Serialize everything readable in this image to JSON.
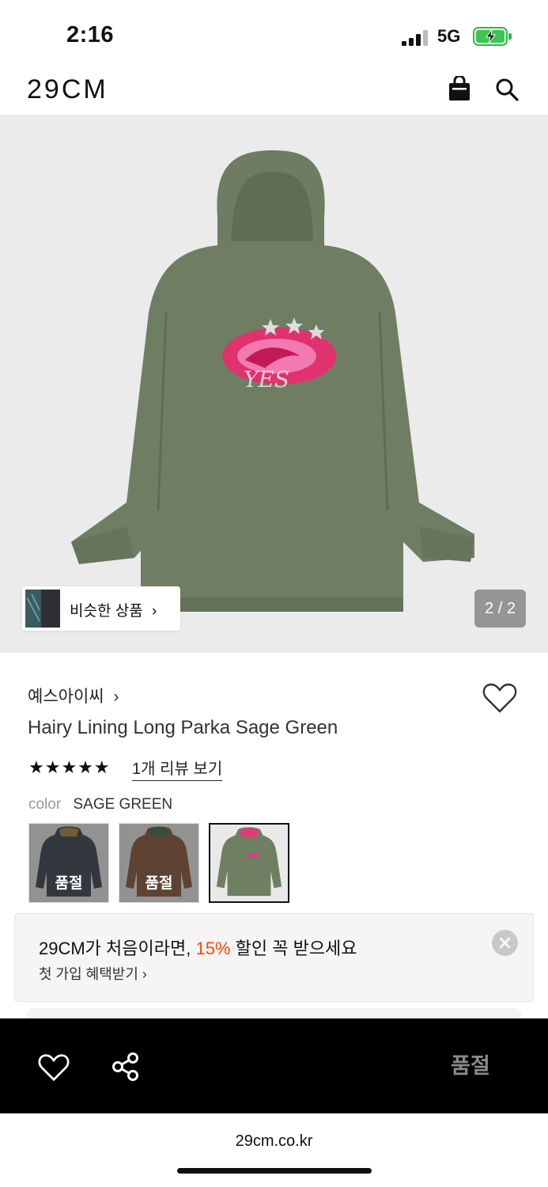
{
  "status_bar": {
    "time": "2:16",
    "network": "5G"
  },
  "header": {
    "logo": "29CM"
  },
  "gallery": {
    "similar_label": "비슷한 상품",
    "similar_chevron": "›",
    "counter": "2 / 2"
  },
  "product": {
    "brand": "예스아이씨",
    "brand_chevron": "›",
    "title": "Hairy Lining Long Parka Sage Green",
    "stars": "★★★★★",
    "review_link": "1개 리뷰 보기",
    "color_key": "color",
    "color_value": "SAGE GREEN",
    "swatches": [
      {
        "label": "품절",
        "color": "#3d4450",
        "sold_out": true
      },
      {
        "label": "품절",
        "color": "#8a5a3c",
        "sold_out": true
      },
      {
        "label": "",
        "color": "#6f7f62",
        "sold_out": false
      }
    ]
  },
  "promo": {
    "line1_prefix": "29CM가 처음이라면, ",
    "line1_highlight": "15%",
    "line1_suffix": " 할인 꼭 받으세요",
    "line2": "첫 가입 혜택받기 ›",
    "highlight_color": "#ff4800"
  },
  "action_bar": {
    "buy_label": "품절"
  },
  "browser": {
    "url": "29cm.co.kr"
  },
  "icons": [
    "bag-icon",
    "search-icon",
    "heart-icon",
    "share-icon",
    "close-icon"
  ]
}
